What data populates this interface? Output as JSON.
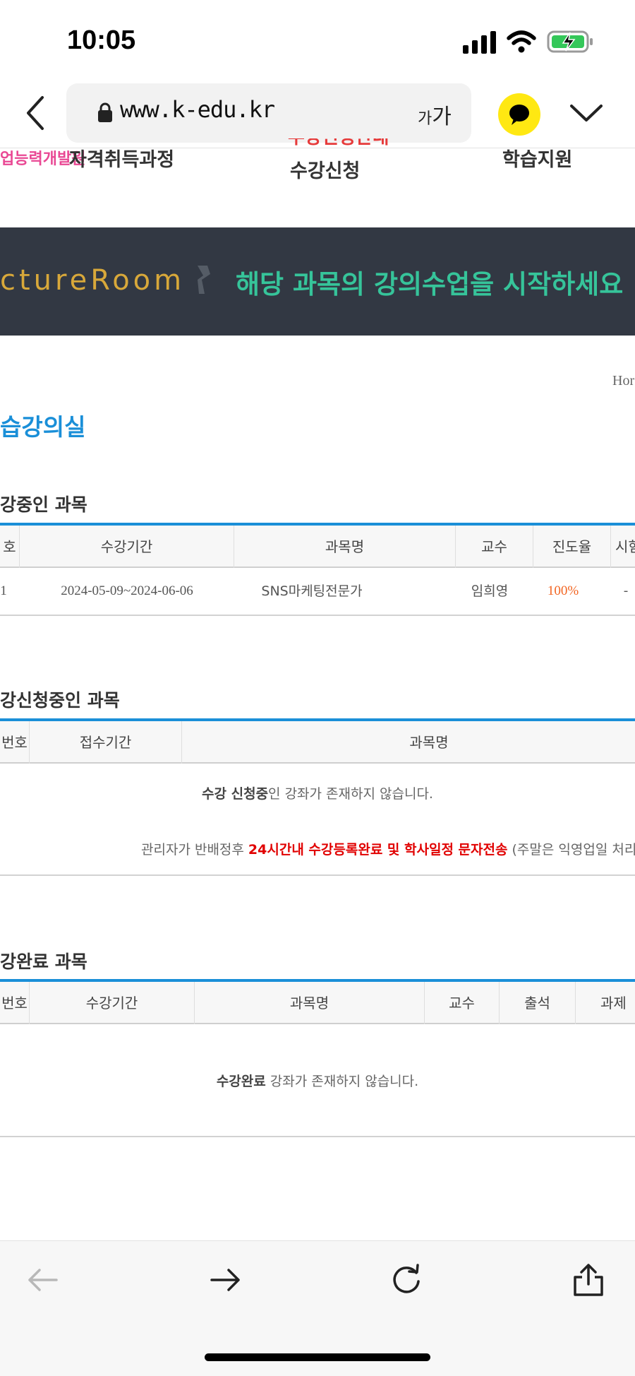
{
  "status_bar": {
    "time": "10:05"
  },
  "browser": {
    "url": "www.k-edu.kr",
    "text_size_small": "가",
    "text_size_large": "가"
  },
  "site_nav": {
    "brand_fragment": "업능력개발원",
    "cert_course": "자격취득과정",
    "enroll": "수강신청",
    "support": "학습지원"
  },
  "banner": {
    "english": "ctureRoom",
    "korean": "해당 과목의 강의수업을 시작하세요"
  },
  "breadcrumb": "Hor",
  "page_title": "습강의실",
  "in_progress": {
    "title": "강중인 과목",
    "headers": [
      "호",
      "수강기간",
      "과목명",
      "교수",
      "진도율",
      "시험"
    ],
    "rows": [
      {
        "no": "1",
        "period": "2024-05-09~2024-06-06",
        "course": "SNS마케팅전문가",
        "professor": "임희영",
        "progress": "100%",
        "exam": "-"
      }
    ]
  },
  "applying": {
    "title": "강신청중인 과목",
    "headers": [
      "번호",
      "접수기간",
      "과목명"
    ],
    "empty_bold": "수강 신청중",
    "empty_rest": "인 강좌가 존재하지 않습니다.",
    "notice_prefix": "관리자가 반배정후 ",
    "notice_red": "24시간내 수강등록완료 및 학사일정 문자전송",
    "notice_suffix": " (주말은 익영업일 처리"
  },
  "completed": {
    "title": "강완료 과목",
    "headers": [
      "번호",
      "수강기간",
      "과목명",
      "교수",
      "출석",
      "과제"
    ],
    "empty_bold": "수강완료",
    "empty_rest": " 강좌가 존재하지 않습니다."
  },
  "colors": {
    "accent_blue": "#1a8fd8",
    "banner_bg": "#323843",
    "banner_green": "#36c49a",
    "banner_gold": "#d8a83a",
    "progress_orange": "#f26522",
    "notice_red": "#e10000",
    "kakao_yellow": "#ffe812"
  }
}
